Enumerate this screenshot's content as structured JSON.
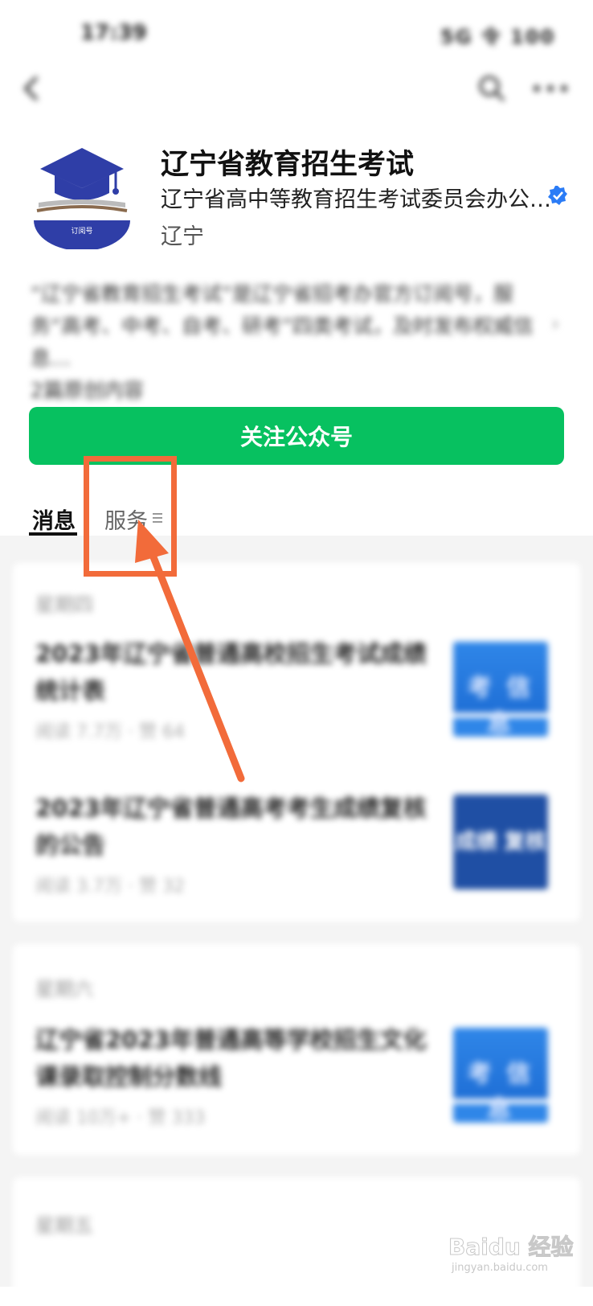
{
  "status_bar": {
    "time": "17:39",
    "indicators": "5G 令 100"
  },
  "nav": {
    "back_icon": "chevron-left-icon",
    "search_icon": "search-icon",
    "more_icon": "more-dots-icon"
  },
  "account": {
    "name": "辽宁省教育招生考试",
    "organization": "辽宁省高中等教育招生考试委员会办公…",
    "region": "辽宁",
    "logo_text": "订阅号",
    "intro": "“辽宁省教育招生考试”是辽宁省招考办官方订阅号，服务“高考、中考、自考、研考”四类考试，及时发布权威信息…",
    "intro_more": "",
    "intro_count": "2篇原创内容"
  },
  "follow_button": {
    "label": "关注公众号"
  },
  "tabs": [
    {
      "label": "消息",
      "active": true
    },
    {
      "label": "服务",
      "active": false
    }
  ],
  "feed": [
    {
      "date": "星期四",
      "articles": [
        {
          "title": "2023年辽宁省普通高校招生考试成绩统计表",
          "meta": "阅读 7.7万 · 赞 64",
          "thumb_text": "考 信 息"
        },
        {
          "title": "2023年辽宁省普通高考考生成绩复核的公告",
          "meta": "阅读 3.7万 · 赞 32",
          "thumb_text": "成绩 复核"
        }
      ]
    },
    {
      "date": "星期六",
      "articles": [
        {
          "title": "辽宁省2023年普通高等学校招生文化课录取控制分数线",
          "meta": "阅读 10万+ · 赞 333",
          "thumb_text": "考 信 息"
        }
      ]
    },
    {
      "date": "星期五",
      "articles": []
    }
  ],
  "watermark": {
    "text": "Baidu 经验",
    "sub": "jingyan.baidu.com"
  },
  "colors": {
    "accent_green": "#07c160",
    "annotation_orange": "#f26b3a",
    "verified_blue": "#2b7cf6"
  }
}
